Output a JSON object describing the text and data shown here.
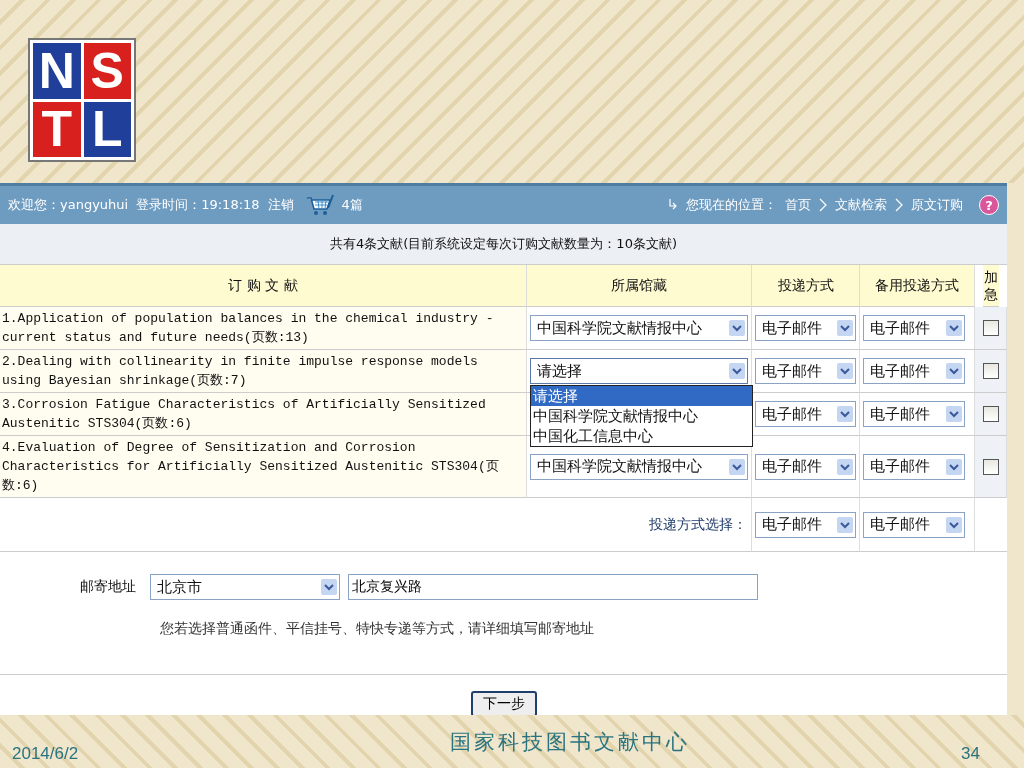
{
  "logo": {
    "letters": [
      "N",
      "S",
      "T",
      "L"
    ]
  },
  "top_bar": {
    "welcome": "欢迎您：yangyuhui",
    "login_time": "登录时间：19:18:18",
    "logout": "注销",
    "cart_count": "4篇",
    "location_label": "您现在的位置：",
    "breadcrumb": [
      "首页",
      "文献检索",
      "原文订购"
    ],
    "help": "?"
  },
  "summary": "共有4条文献(目前系统设定每次订购文献数量为：10条文献)",
  "table": {
    "columns": [
      "订 购 文 献",
      "所属馆藏",
      "投递方式",
      "备用投递方式",
      "加急"
    ],
    "rows": [
      {
        "title": "1.Application of population balances in the chemical industry - current status and future needs(页数:13)",
        "library": "中国科学院文献情报中心",
        "delivery": "电子邮件",
        "backup": "电子邮件",
        "urgent": false,
        "expanded": false
      },
      {
        "title": "2.Dealing with collinearity in finite impulse response models using Bayesian shrinkage(页数:7)",
        "library": "请选择",
        "delivery": "电子邮件",
        "backup": "电子邮件",
        "urgent": false,
        "expanded": true,
        "options": [
          {
            "label": "请选择",
            "selected": true
          },
          {
            "label": "中国科学院文献情报中心",
            "selected": false
          },
          {
            "label": "中国化工信息中心",
            "selected": false
          }
        ]
      },
      {
        "title": "3.Corrosion Fatigue Characteristics of Artificially Sensitized Austenitic STS304(页数:6)",
        "delivery": "电子邮件",
        "backup": "电子邮件",
        "urgent": false
      },
      {
        "title": "4.Evaluation of Degree of Sensitization and Corrosion Characteristics for Artificially Sensitized Austenitic STS304(页数:6)",
        "library": "中国科学院文献情报中心",
        "delivery": "电子邮件",
        "backup": "电子邮件",
        "urgent": false,
        "expanded": false
      }
    ]
  },
  "delivery_choice": {
    "label": "投递方式选择：",
    "delivery": "电子邮件",
    "backup": "电子邮件"
  },
  "mail": {
    "label": "邮寄地址",
    "city": "北京市",
    "address": "北京复兴路",
    "note": "您若选择普通函件、平信挂号、特快专递等方式，请详细填写邮寄地址"
  },
  "next_button": "下一步",
  "footer": {
    "date": "2014/6/2",
    "title": "国家科技图书文献中心",
    "page": "34"
  }
}
